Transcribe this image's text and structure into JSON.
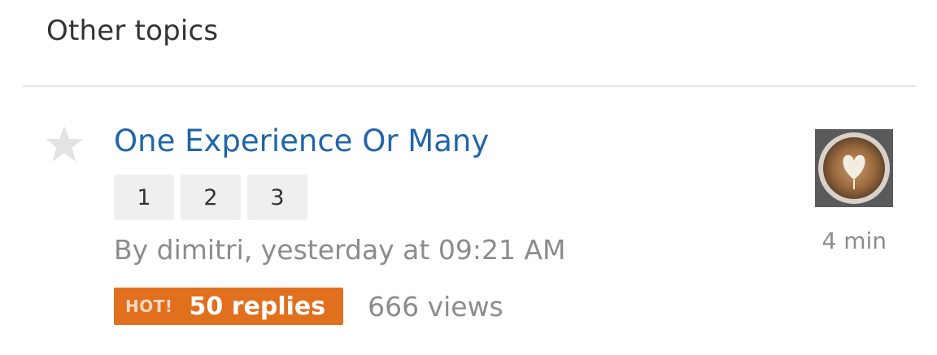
{
  "section": {
    "title": "Other topics"
  },
  "topic": {
    "title": "One Experience Or Many",
    "pages": [
      "1",
      "2",
      "3"
    ],
    "meta": "By dimitri, yesterday at 09:21 AM",
    "hot_label": "HOT!",
    "replies": "50 replies",
    "views": "666 views",
    "last_post_time": "4 min",
    "icons": {
      "favorite": "star-icon",
      "avatar": "latte-art-avatar"
    }
  },
  "colors": {
    "link": "#2166aa",
    "hot_badge": "#e0701e",
    "muted_text": "#8c8c8c",
    "page_button": "#efefef"
  }
}
